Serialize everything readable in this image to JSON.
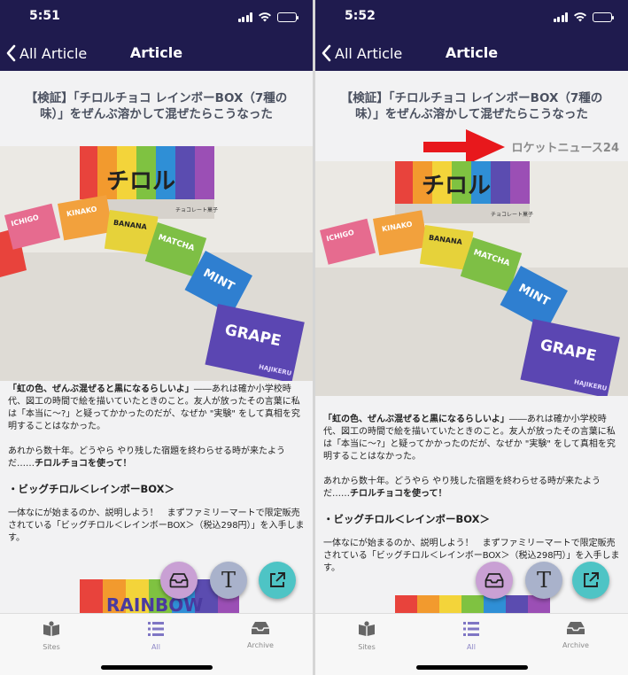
{
  "left": {
    "status": {
      "time": "5:51"
    },
    "nav": {
      "back_label": "All Article",
      "title": "Article"
    },
    "article": {
      "title": "【検証】「チロルチョコ レインボーBOX（7種の味）」をぜんぶ溶かして混ぜたらこうなった"
    }
  },
  "right": {
    "status": {
      "time": "5:52"
    },
    "nav": {
      "back_label": "All Article",
      "title": "Article"
    },
    "article": {
      "title": "【検証】「チロルチョコ レインボーBOX（7種の味）」をぜんぶ溶かして混ぜたらこうなった",
      "source": "ロケットニュース24"
    }
  },
  "body": {
    "p1_bold": "「虹の色、ぜんぶ混ぜると黒になるらしいよ」",
    "p1_rest": "――あれは確か小学校時代、図工の時間で絵を描いていたときのこと。友人が放ったその言葉に私は「本当に～?」と疑ってかかったのだが、なぜか \"実験\" をして真相を究明することはなかった。",
    "p2_rest": "あれから数十年。どうやら やり残した宿題を終わらせる時が来たようだ……",
    "p2_bold": "チロルチョコを使って！",
    "heading": "・ビッグチロル＜レインボーBOX＞",
    "p3": "一体なにが始まるのか、説明しよう！　まずファミリーマートで限定販売されている「ビッグチロル＜レインボーBOX＞（税込298円）」を入手します。"
  },
  "photo_labels": {
    "brand": "チロル",
    "ichigo": "ICHIGO",
    "kinako": "KINAKO",
    "banana": "BANANA",
    "matcha": "MATCHA",
    "mint": "MINT",
    "grape": "GRAPE",
    "maker": "チョコレート菓子",
    "hajikeru": "HAJIKERU"
  },
  "bottom_img_text": "RAINBOW",
  "tabs": {
    "sites": "Sites",
    "all": "All",
    "archive": "Archive"
  },
  "colors": {
    "nav_bg": "#1f1b4e",
    "fab_inbox": "#c9a0d4",
    "fab_text": "#a9b2cb",
    "fab_open": "#4ec4c5",
    "arrow": "#e8181c"
  },
  "icons": {
    "back": "chevron-left-icon",
    "inbox": "inbox-icon",
    "text": "text-format-icon",
    "open": "open-external-icon",
    "sites": "book-icon",
    "all": "list-icon",
    "archive": "archive-icon"
  }
}
